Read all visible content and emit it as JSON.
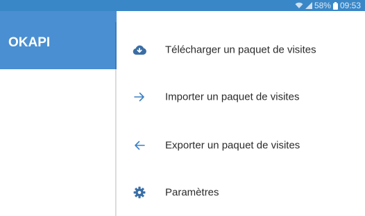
{
  "status_bar": {
    "battery": "58%",
    "time": "09:53",
    "icons": [
      "wifi-icon",
      "signal-icon",
      "battery-icon"
    ]
  },
  "app_bar": {
    "title": "OKAPI",
    "color": "#4a8fd1"
  },
  "menu": {
    "items": [
      {
        "label": "Télécharger un paquet de visites",
        "icon": "cloud-download-icon"
      },
      {
        "label": "Importer un paquet de visites",
        "icon": "arrow-right-icon"
      },
      {
        "label": "Exporter un paquet de visites",
        "icon": "arrow-left-icon"
      },
      {
        "label": "Paramètres",
        "icon": "gear-icon"
      }
    ]
  },
  "colors": {
    "status_bar": "#3a87c7",
    "accent": "#3d7fc4",
    "icon_dark": "#3a6ea5"
  }
}
